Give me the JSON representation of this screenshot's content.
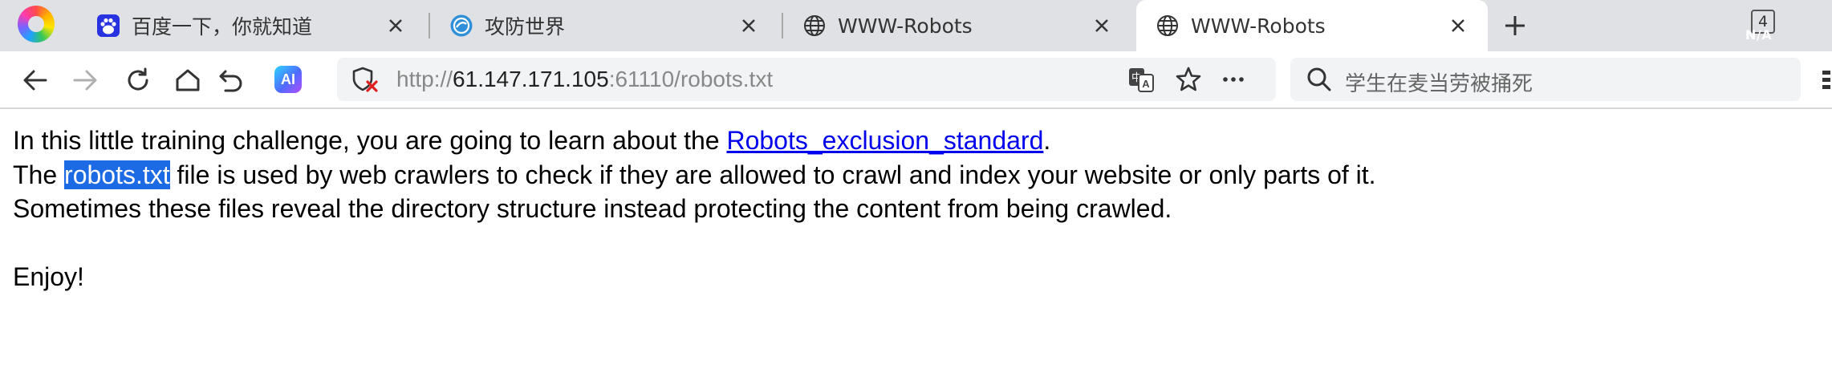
{
  "tabs": [
    {
      "title": "百度一下，你就知道",
      "favicon": "baidu-paw-icon",
      "active": false
    },
    {
      "title": "攻防世界",
      "favicon": "adworld-icon",
      "active": false
    },
    {
      "title": "WWW-Robots",
      "favicon": "globe-icon",
      "active": false
    },
    {
      "title": "WWW-Robots",
      "favicon": "globe-icon",
      "active": true
    }
  ],
  "tab_count": "4",
  "net_status": "N/A",
  "toolbar": {
    "ai_label": "AI"
  },
  "address": {
    "scheme": "http://",
    "host": "61.147.171.105",
    "path": ":61110/robots.txt"
  },
  "search": {
    "text": "学生在麦当劳被捅死"
  },
  "content": {
    "line1_before": "In this little training challenge, you are going to learn about the ",
    "line1_link": "Robots_exclusion_standard",
    "line1_after": ".",
    "line2_before": "The ",
    "line2_highlight": "robots.txt",
    "line2_after": " file is used by web crawlers to check if they are allowed to crawl and index your website or only parts of it.",
    "line3": "Sometimes these files reveal the directory structure instead protecting the content from being crawled.",
    "line4": "Enjoy!"
  },
  "colors": {
    "tabstrip_bg": "#dfe1e5",
    "link": "#0000ee",
    "selection": "#1d6ae5"
  }
}
